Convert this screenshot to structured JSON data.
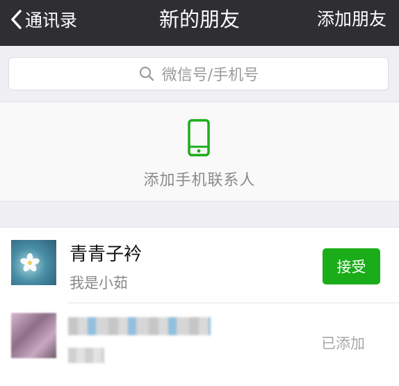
{
  "nav": {
    "back_label": "通讯录",
    "title": "新的朋友",
    "action_label": "添加朋友"
  },
  "search": {
    "placeholder": "微信号/手机号"
  },
  "add_contacts": {
    "label": "添加手机联系人"
  },
  "requests": [
    {
      "name": "青青子衿",
      "message": "我是小茹",
      "action_label": "接受"
    },
    {
      "name": "",
      "message": "",
      "status_label": "已添加"
    }
  ],
  "colors": {
    "nav_background": "#2f2f33",
    "accent_green": "#1aad19",
    "phone_icon_green": "#1aad19"
  },
  "icons": {
    "back": "chevron-left-icon",
    "search": "search-icon",
    "phone": "phone-icon"
  }
}
